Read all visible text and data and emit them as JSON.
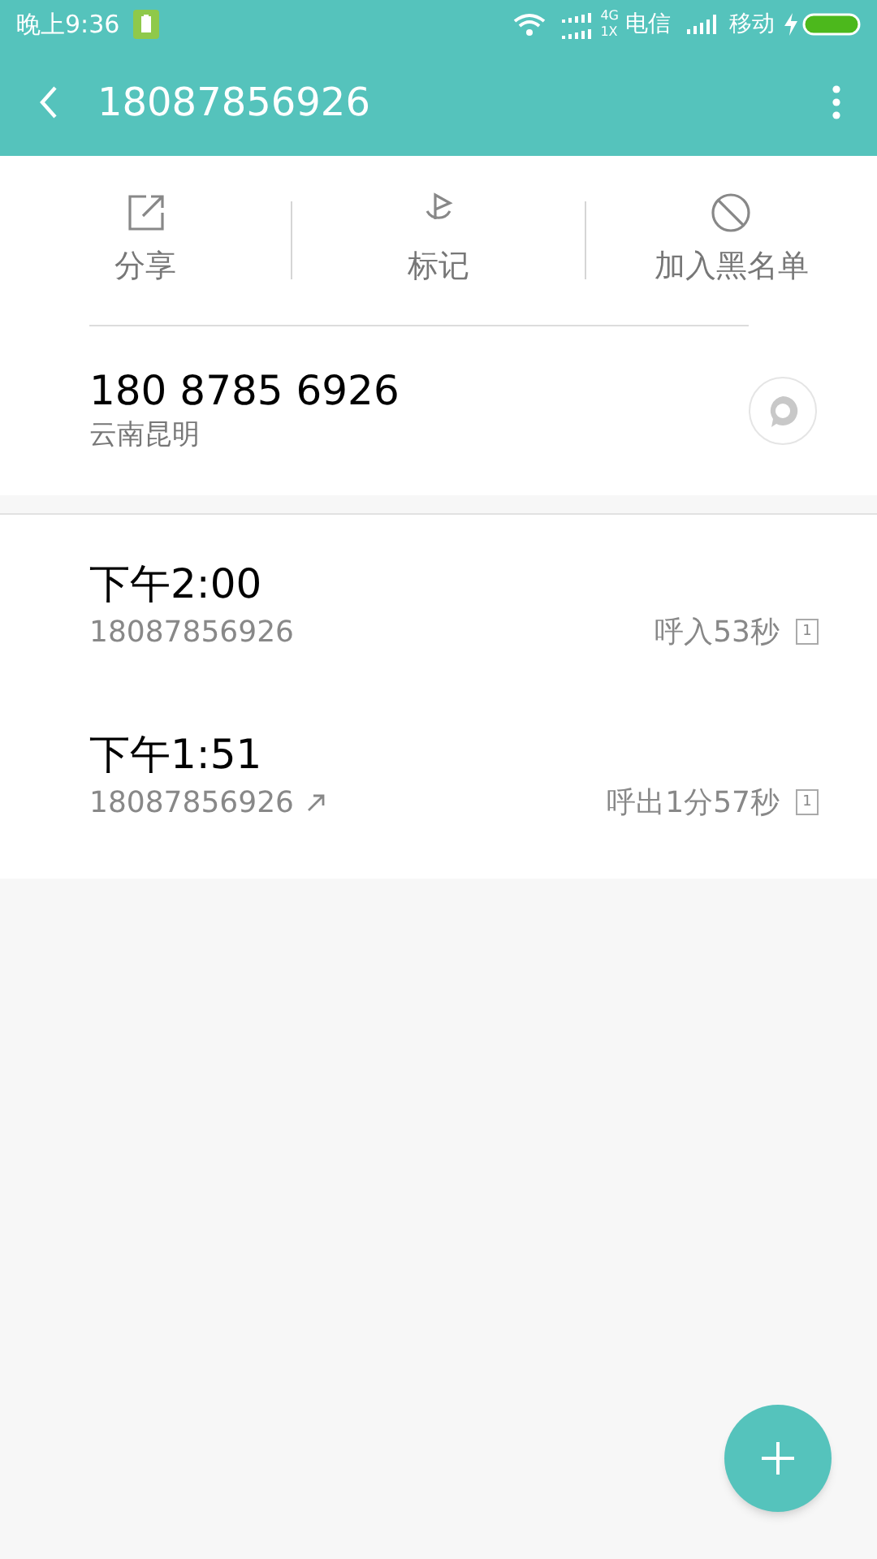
{
  "status_bar": {
    "time": "晚上9:36",
    "network_top": "4G",
    "network_bottom": "1X",
    "carrier_1": "电信",
    "carrier_2": "移动"
  },
  "header": {
    "title": "18087856926"
  },
  "actions": [
    {
      "label": "分享",
      "kind": "share"
    },
    {
      "label": "标记",
      "kind": "mark"
    },
    {
      "label": "加入黑名单",
      "kind": "block"
    }
  ],
  "contact": {
    "number": "180 8785 6926",
    "location": "云南昆明"
  },
  "calls": [
    {
      "time": "下午2:00",
      "number": "18087856926",
      "outgoing": false,
      "duration": "呼入53秒",
      "sim": "1"
    },
    {
      "time": "下午1:51",
      "number": "18087856926",
      "outgoing": true,
      "duration": "呼出1分57秒",
      "sim": "1"
    }
  ]
}
